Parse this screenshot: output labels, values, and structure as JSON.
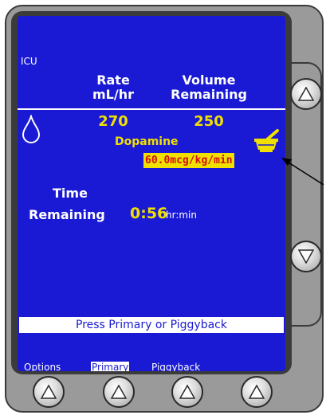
{
  "screen": {
    "location": "ICU",
    "rate_header_1": "Rate",
    "rate_header_2": "mL/hr",
    "volume_header_1": "Volume",
    "volume_header_2": "Remaining",
    "rate_value": "270",
    "volume_value": "250",
    "drug_name": "Dopamine",
    "dose": "60.0mcg/kg/min",
    "time_label_1": "Time",
    "time_label_2": "Remaining",
    "time_value": "0:56",
    "time_unit": "hr:min",
    "prompt": "Press Primary or Piggyback"
  },
  "softkeys": {
    "options": "Options",
    "primary": "Primary",
    "piggyback": "Piggyback"
  },
  "icons": {
    "drop": "drop-icon",
    "mortar": "mortar-pestle-icon",
    "up": "up-arrow-icon",
    "down": "down-arrow-icon"
  },
  "colors": {
    "screen_bg": "#1a1ad4",
    "value_yellow": "#f0e000",
    "dose_red": "#d01010"
  }
}
